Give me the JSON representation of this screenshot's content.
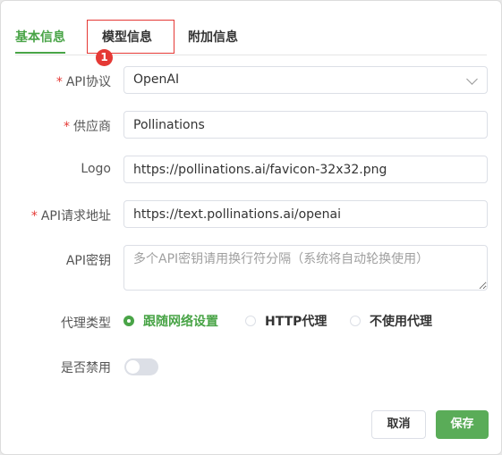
{
  "tabs": [
    {
      "label": "基本信息",
      "active": true
    },
    {
      "label": "模型信息",
      "active": false
    },
    {
      "label": "附加信息",
      "active": false
    }
  ],
  "annotation": {
    "badge": "1",
    "color": "#e53935"
  },
  "form": {
    "api_protocol": {
      "label": "API协议",
      "required": "*",
      "value": "OpenAI"
    },
    "provider": {
      "label": "供应商",
      "required": "*",
      "value": "Pollinations"
    },
    "logo": {
      "label": "Logo",
      "value": "https://pollinations.ai/favicon-32x32.png"
    },
    "api_url": {
      "label": "API请求地址",
      "required": "*",
      "value": "https://text.pollinations.ai/openai"
    },
    "api_key": {
      "label": "API密钥",
      "value": "",
      "placeholder": "多个API密钥请用换行符分隔（系统将自动轮换使用）"
    },
    "proxy_type": {
      "label": "代理类型",
      "options": [
        {
          "label": "跟随网络设置",
          "checked": true
        },
        {
          "label": "HTTP代理",
          "checked": false
        },
        {
          "label": "不使用代理",
          "checked": false
        }
      ]
    },
    "disabled": {
      "label": "是否禁用",
      "on": false
    }
  },
  "buttons": {
    "cancel": "取消",
    "save": "保存"
  },
  "colors": {
    "accent": "#49a447",
    "save_button": "#5aac58",
    "required": "#e53935"
  }
}
